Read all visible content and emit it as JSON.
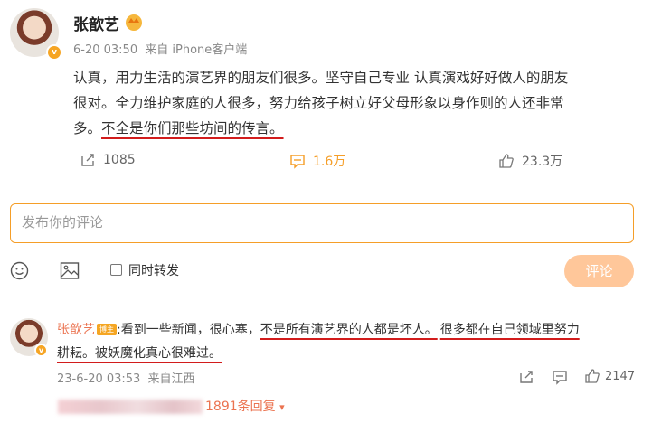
{
  "post": {
    "author": "张歆艺",
    "time": "6-20 03:50",
    "source": "来自 iPhone客户端",
    "text_line1": "认真，用力生活的演艺界的朋友们很多。坚守自己专业 认真演戏好好做人的朋友",
    "text_line2": "很对。全力维护家庭的人很多，努力给孩子树立好父母形象以身作则的人还非常",
    "text_line3_a": "多。",
    "text_line3_b": "不全是你们那些坊间的传言。",
    "repost_count": "1085",
    "comment_count": "1.6万",
    "like_count": "23.3万"
  },
  "composer": {
    "placeholder": "发布你的评论",
    "repost_label": "同时转发",
    "submit_label": "评论"
  },
  "comment": {
    "author": "张歆艺",
    "level_badge": "博主",
    "text_a": ":看到一些新闻，很心塞，",
    "text_b": "不是所有演艺界的人都是坏人。",
    "text_c": "很多都在自己领域里努力",
    "text_d": "耕耘。",
    "text_e": "被妖魔化真心很难过。",
    "time": "23-6-20 03:53",
    "source": "来自江西",
    "like_count": "2147",
    "replies_label": "1891条回复",
    "replies_arrow": "▾"
  },
  "colors": {
    "accent": "#f59e28",
    "link": "#eb7350",
    "underline": "#d21c1c"
  }
}
